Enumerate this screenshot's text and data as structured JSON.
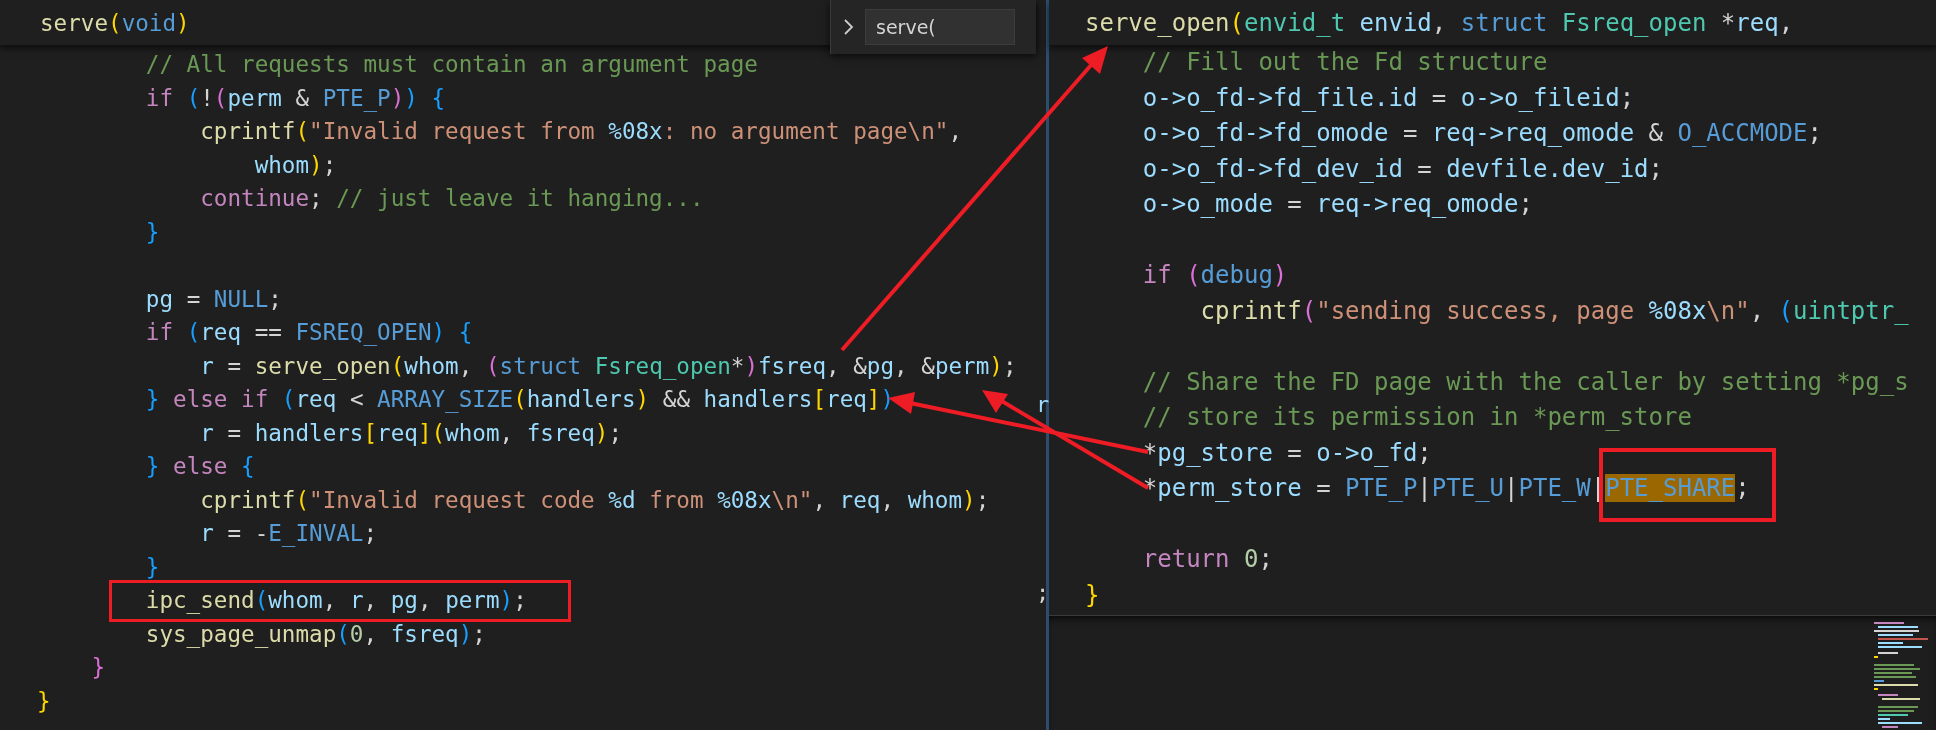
{
  "left_editor": {
    "sticky_header": {
      "tokens": [
        {
          "text": "serve",
          "kind": "fn"
        },
        {
          "text": "(",
          "kind": "b1"
        },
        {
          "text": "void",
          "kind": "kw"
        },
        {
          "text": ")",
          "kind": "b1"
        }
      ]
    },
    "find_widget": {
      "query": "serve("
    },
    "lines": [
      {
        "kind": "code",
        "tokens": [
          {
            "text": "        // All requests must contain an argument page",
            "kind": "com"
          }
        ]
      },
      {
        "kind": "code",
        "tokens": [
          {
            "text": "        if",
            "kind": "ctl"
          },
          {
            "text": " (",
            "kind": "b3"
          },
          {
            "text": "!",
            "kind": "txt"
          },
          {
            "text": "(",
            "kind": "b2"
          },
          {
            "text": "perm",
            "kind": "var"
          },
          {
            "text": " & ",
            "kind": "txt"
          },
          {
            "text": "PTE_P",
            "kind": "kw"
          },
          {
            "text": ")",
            "kind": "b2"
          },
          {
            "text": ")",
            "kind": "b3"
          },
          {
            "text": " {",
            "kind": "b3"
          }
        ]
      },
      {
        "kind": "code",
        "tokens": [
          {
            "text": "            cprintf",
            "kind": "fn"
          },
          {
            "text": "(",
            "kind": "b1"
          },
          {
            "text": "\"Invalid request from ",
            "kind": "str"
          },
          {
            "text": "%08x",
            "kind": "fmt"
          },
          {
            "text": ": no argument page\\n\"",
            "kind": "str"
          },
          {
            "text": ",",
            "kind": "txt"
          }
        ]
      },
      {
        "kind": "code",
        "tokens": [
          {
            "text": "                whom",
            "kind": "var"
          },
          {
            "text": ")",
            "kind": "b1"
          },
          {
            "text": ";",
            "kind": "txt"
          }
        ]
      },
      {
        "kind": "code",
        "tokens": [
          {
            "text": "            continue",
            "kind": "ctl"
          },
          {
            "text": ";",
            "kind": "txt"
          },
          {
            "text": " // just leave it hanging...",
            "kind": "com"
          }
        ]
      },
      {
        "kind": "code",
        "tokens": [
          {
            "text": "        }",
            "kind": "b3"
          }
        ]
      },
      {
        "kind": "blank"
      },
      {
        "kind": "code",
        "tokens": [
          {
            "text": "        pg",
            "kind": "var"
          },
          {
            "text": " = ",
            "kind": "txt"
          },
          {
            "text": "NULL",
            "kind": "kw"
          },
          {
            "text": ";",
            "kind": "txt"
          }
        ]
      },
      {
        "kind": "code",
        "tokens": [
          {
            "text": "        if",
            "kind": "ctl"
          },
          {
            "text": " (",
            "kind": "b3"
          },
          {
            "text": "req",
            "kind": "var"
          },
          {
            "text": " == ",
            "kind": "txt"
          },
          {
            "text": "FSREQ_OPEN",
            "kind": "kw"
          },
          {
            "text": ")",
            "kind": "b3"
          },
          {
            "text": " {",
            "kind": "b3"
          }
        ]
      },
      {
        "kind": "code",
        "tokens": [
          {
            "text": "            r",
            "kind": "var"
          },
          {
            "text": " = ",
            "kind": "txt"
          },
          {
            "text": "serve_open",
            "kind": "fn"
          },
          {
            "text": "(",
            "kind": "b1"
          },
          {
            "text": "whom",
            "kind": "var"
          },
          {
            "text": ", ",
            "kind": "txt"
          },
          {
            "text": "(",
            "kind": "b2"
          },
          {
            "text": "struct",
            "kind": "kw"
          },
          {
            "text": " Fsreq_open",
            "kind": "type"
          },
          {
            "text": "*",
            "kind": "txt"
          },
          {
            "text": ")",
            "kind": "b2"
          },
          {
            "text": "fsreq",
            "kind": "var"
          },
          {
            "text": ", &",
            "kind": "txt"
          },
          {
            "text": "pg",
            "kind": "var"
          },
          {
            "text": ", &",
            "kind": "txt"
          },
          {
            "text": "perm",
            "kind": "var"
          },
          {
            "text": ")",
            "kind": "b1"
          },
          {
            "text": ";",
            "kind": "txt"
          }
        ]
      },
      {
        "kind": "code",
        "tokens": [
          {
            "text": "        }",
            "kind": "b3"
          },
          {
            "text": " else",
            "kind": "ctl"
          },
          {
            "text": " if",
            "kind": "ctl"
          },
          {
            "text": " (",
            "kind": "b3"
          },
          {
            "text": "req",
            "kind": "var"
          },
          {
            "text": " < ",
            "kind": "txt"
          },
          {
            "text": "ARRAY_SIZE",
            "kind": "kw"
          },
          {
            "text": "(",
            "kind": "b1"
          },
          {
            "text": "handlers",
            "kind": "var"
          },
          {
            "text": ")",
            "kind": "b1"
          },
          {
            "text": " && ",
            "kind": "txt"
          },
          {
            "text": "handlers",
            "kind": "var"
          },
          {
            "text": "[",
            "kind": "b1"
          },
          {
            "text": "req",
            "kind": "var"
          },
          {
            "text": "]",
            "kind": "b1"
          },
          {
            "text": ")",
            "kind": "b3"
          }
        ]
      },
      {
        "kind": "code",
        "tokens": [
          {
            "text": "            r",
            "kind": "var"
          },
          {
            "text": " = ",
            "kind": "txt"
          },
          {
            "text": "handlers",
            "kind": "var"
          },
          {
            "text": "[",
            "kind": "b1"
          },
          {
            "text": "req",
            "kind": "var"
          },
          {
            "text": "]",
            "kind": "b1"
          },
          {
            "text": "(",
            "kind": "b1"
          },
          {
            "text": "whom",
            "kind": "var"
          },
          {
            "text": ", ",
            "kind": "txt"
          },
          {
            "text": "fsreq",
            "kind": "var"
          },
          {
            "text": ")",
            "kind": "b1"
          },
          {
            "text": ";",
            "kind": "txt"
          }
        ]
      },
      {
        "kind": "code",
        "tokens": [
          {
            "text": "        }",
            "kind": "b3"
          },
          {
            "text": " else",
            "kind": "ctl"
          },
          {
            "text": " {",
            "kind": "b3"
          }
        ]
      },
      {
        "kind": "code",
        "tokens": [
          {
            "text": "            cprintf",
            "kind": "fn"
          },
          {
            "text": "(",
            "kind": "b1"
          },
          {
            "text": "\"Invalid request code ",
            "kind": "str"
          },
          {
            "text": "%d",
            "kind": "fmt"
          },
          {
            "text": " from ",
            "kind": "str"
          },
          {
            "text": "%08x",
            "kind": "fmt"
          },
          {
            "text": "\\n\"",
            "kind": "str"
          },
          {
            "text": ", ",
            "kind": "txt"
          },
          {
            "text": "req",
            "kind": "var"
          },
          {
            "text": ", ",
            "kind": "txt"
          },
          {
            "text": "whom",
            "kind": "var"
          },
          {
            "text": ")",
            "kind": "b1"
          },
          {
            "text": ";",
            "kind": "txt"
          }
        ]
      },
      {
        "kind": "code",
        "tokens": [
          {
            "text": "            r",
            "kind": "var"
          },
          {
            "text": " = -",
            "kind": "txt"
          },
          {
            "text": "E_INVAL",
            "kind": "kw"
          },
          {
            "text": ";",
            "kind": "txt"
          }
        ]
      },
      {
        "kind": "code",
        "tokens": [
          {
            "text": "        }",
            "kind": "b3"
          }
        ]
      },
      {
        "kind": "boxed",
        "tokens": [
          {
            "text": "        ipc_send",
            "kind": "fn"
          },
          {
            "text": "(",
            "kind": "b3"
          },
          {
            "text": "whom",
            "kind": "var"
          },
          {
            "text": ", ",
            "kind": "txt"
          },
          {
            "text": "r",
            "kind": "var"
          },
          {
            "text": ", ",
            "kind": "txt"
          },
          {
            "text": "pg",
            "kind": "var"
          },
          {
            "text": ", ",
            "kind": "txt"
          },
          {
            "text": "perm",
            "kind": "var"
          },
          {
            "text": ")",
            "kind": "b3"
          },
          {
            "text": ";",
            "kind": "txt"
          }
        ]
      },
      {
        "kind": "code",
        "tokens": [
          {
            "text": "        sys_page_unmap",
            "kind": "fn"
          },
          {
            "text": "(",
            "kind": "b3"
          },
          {
            "text": "0",
            "kind": "num"
          },
          {
            "text": ", ",
            "kind": "txt"
          },
          {
            "text": "fsreq",
            "kind": "var"
          },
          {
            "text": ")",
            "kind": "b3"
          },
          {
            "text": ";",
            "kind": "txt"
          }
        ]
      },
      {
        "kind": "code",
        "tokens": [
          {
            "text": "    }",
            "kind": "b2"
          }
        ]
      },
      {
        "kind": "code",
        "tokens": [
          {
            "text": "}",
            "kind": "b1"
          }
        ]
      }
    ]
  },
  "gutter_fragments": [
    "r",
    ";"
  ],
  "peek_editor": {
    "sticky_header": {
      "tokens": [
        {
          "text": "serve_open",
          "kind": "fn"
        },
        {
          "text": "(",
          "kind": "b1"
        },
        {
          "text": "envid_t",
          "kind": "type"
        },
        {
          "text": " envid",
          "kind": "var"
        },
        {
          "text": ", ",
          "kind": "txt"
        },
        {
          "text": "struct",
          "kind": "kw"
        },
        {
          "text": " Fsreq_open",
          "kind": "type"
        },
        {
          "text": " *",
          "kind": "txt"
        },
        {
          "text": "req",
          "kind": "var"
        },
        {
          "text": ",",
          "kind": "txt"
        }
      ]
    },
    "lines": [
      {
        "kind": "code",
        "tokens": [
          {
            "text": "    // Fill out the Fd structure",
            "kind": "com"
          }
        ]
      },
      {
        "kind": "code",
        "tokens": [
          {
            "text": "    o->o_fd->fd_file.id",
            "kind": "var"
          },
          {
            "text": " = ",
            "kind": "txt"
          },
          {
            "text": "o->o_fileid",
            "kind": "var"
          },
          {
            "text": ";",
            "kind": "txt"
          }
        ]
      },
      {
        "kind": "code",
        "tokens": [
          {
            "text": "    o->o_fd->fd_omode",
            "kind": "var"
          },
          {
            "text": " = ",
            "kind": "txt"
          },
          {
            "text": "req->req_omode",
            "kind": "var"
          },
          {
            "text": " & ",
            "kind": "txt"
          },
          {
            "text": "O_ACCMODE",
            "kind": "kw"
          },
          {
            "text": ";",
            "kind": "txt"
          }
        ]
      },
      {
        "kind": "code",
        "tokens": [
          {
            "text": "    o->o_fd->fd_dev_id",
            "kind": "var"
          },
          {
            "text": " = ",
            "kind": "txt"
          },
          {
            "text": "devfile.dev_id",
            "kind": "var"
          },
          {
            "text": ";",
            "kind": "txt"
          }
        ]
      },
      {
        "kind": "code",
        "tokens": [
          {
            "text": "    o->o_mode",
            "kind": "var"
          },
          {
            "text": " = ",
            "kind": "txt"
          },
          {
            "text": "req->req_omode",
            "kind": "var"
          },
          {
            "text": ";",
            "kind": "txt"
          }
        ]
      },
      {
        "kind": "blank"
      },
      {
        "kind": "code",
        "tokens": [
          {
            "text": "    if",
            "kind": "ctl"
          },
          {
            "text": " (",
            "kind": "b2"
          },
          {
            "text": "debug",
            "kind": "kw"
          },
          {
            "text": ")",
            "kind": "b2"
          }
        ]
      },
      {
        "kind": "code",
        "tokens": [
          {
            "text": "        cprintf",
            "kind": "fn"
          },
          {
            "text": "(",
            "kind": "b2"
          },
          {
            "text": "\"sending success, page ",
            "kind": "str"
          },
          {
            "text": "%08x",
            "kind": "fmt"
          },
          {
            "text": "\\n\"",
            "kind": "str"
          },
          {
            "text": ", ",
            "kind": "txt"
          },
          {
            "text": "(",
            "kind": "b3"
          },
          {
            "text": "uintptr_",
            "kind": "type"
          }
        ]
      },
      {
        "kind": "blank"
      },
      {
        "kind": "code",
        "tokens": [
          {
            "text": "    // Share the FD page with the caller by setting *pg_s",
            "kind": "com"
          }
        ]
      },
      {
        "kind": "code",
        "tokens": [
          {
            "text": "    // store its permission in *perm_store",
            "kind": "com"
          }
        ]
      },
      {
        "kind": "code",
        "tokens": [
          {
            "text": "    *",
            "kind": "txt"
          },
          {
            "text": "pg_store",
            "kind": "var"
          },
          {
            "text": " = ",
            "kind": "txt"
          },
          {
            "text": "o->o_fd",
            "kind": "var"
          },
          {
            "text": ";",
            "kind": "txt"
          }
        ]
      },
      {
        "kind": "code",
        "tokens": [
          {
            "text": "    *",
            "kind": "txt"
          },
          {
            "text": "perm_store",
            "kind": "var"
          },
          {
            "text": " = ",
            "kind": "txt"
          },
          {
            "text": "PTE_P",
            "kind": "kw"
          },
          {
            "text": "|",
            "kind": "txt"
          },
          {
            "text": "PTE_U",
            "kind": "kw"
          },
          {
            "text": "|",
            "kind": "txt"
          },
          {
            "text": "PTE_W",
            "kind": "kw"
          },
          {
            "text": "|",
            "kind": "txt"
          },
          {
            "text": "PTE_SHARE",
            "kind": "match"
          },
          {
            "text": ";",
            "kind": "txt"
          }
        ]
      },
      {
        "kind": "blank"
      },
      {
        "kind": "code",
        "tokens": [
          {
            "text": "    return",
            "kind": "ctl"
          },
          {
            "text": " 0",
            "kind": "num"
          },
          {
            "text": ";",
            "kind": "txt"
          }
        ]
      },
      {
        "kind": "code",
        "tokens": [
          {
            "text": "}",
            "kind": "b1"
          }
        ]
      }
    ]
  }
}
